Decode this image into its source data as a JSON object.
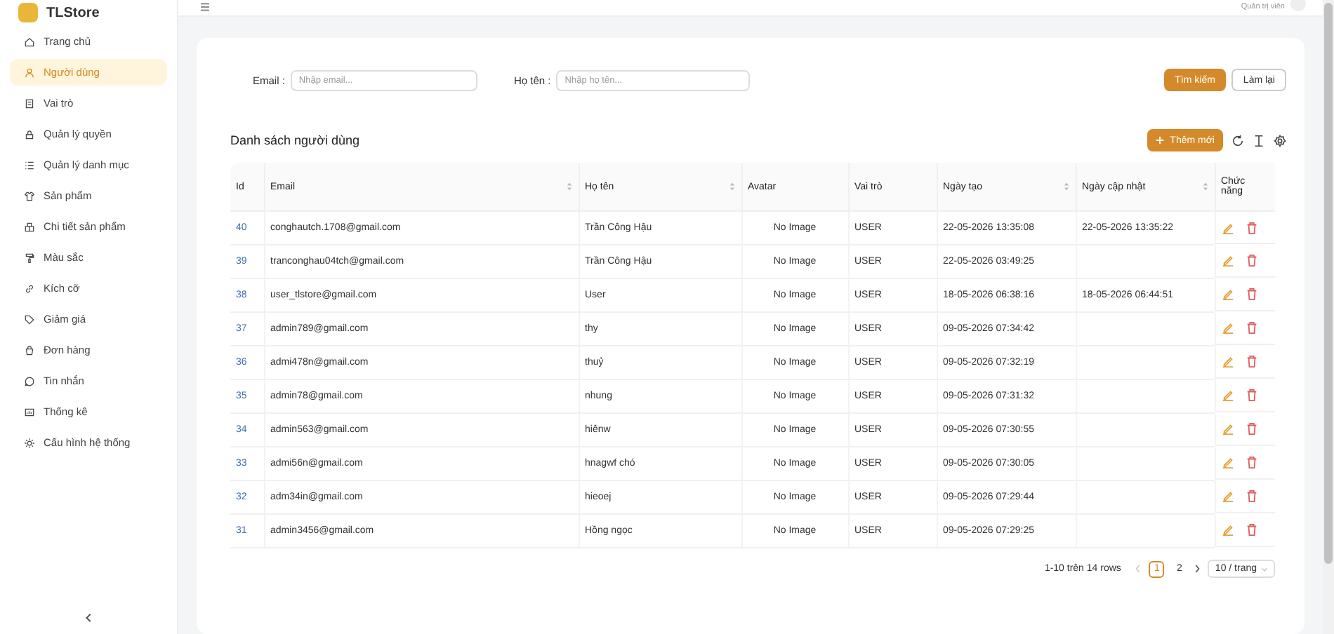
{
  "brand": {
    "name": "TLStore"
  },
  "sidebar": {
    "items": [
      {
        "label": "Trang chủ",
        "selected": false
      },
      {
        "label": "Người dùng",
        "selected": true
      },
      {
        "label": "Vai trò",
        "selected": false
      },
      {
        "label": "Quản lý quyền",
        "selected": false
      },
      {
        "label": "Quản lý danh mục",
        "selected": false
      },
      {
        "label": "Sản phẩm",
        "selected": false
      },
      {
        "label": "Chi tiết sản phẩm",
        "selected": false
      },
      {
        "label": "Màu sắc",
        "selected": false
      },
      {
        "label": "Kích cỡ",
        "selected": false
      },
      {
        "label": "Giảm giá",
        "selected": false
      },
      {
        "label": "Đơn hàng",
        "selected": false
      },
      {
        "label": "Tin nhắn",
        "selected": false
      },
      {
        "label": "Thống kê",
        "selected": false
      },
      {
        "label": "Cấu hình hệ thống",
        "selected": false
      }
    ]
  },
  "header": {
    "user_role": "Quản trị viên"
  },
  "filters": [
    {
      "label": "Email :",
      "placeholder": "Nhập email..."
    },
    {
      "label": "Họ tên :",
      "placeholder": "Nhập họ tên..."
    }
  ],
  "filter_buttons": [
    {
      "label": "Tìm kiếm",
      "kind": "primary"
    },
    {
      "label": "Làm lại",
      "kind": "default"
    }
  ],
  "table_title": "Danh sách người dùng",
  "add_button": "Thêm mới",
  "table": {
    "columns": [
      {
        "label": "Id",
        "sortable": false
      },
      {
        "label": "Email",
        "sortable": true
      },
      {
        "label": "Họ tên",
        "sortable": true
      },
      {
        "label": "Avatar",
        "sortable": false
      },
      {
        "label": "Vai trò",
        "sortable": false
      },
      {
        "label": "Ngày tạo",
        "sortable": true
      },
      {
        "label": "Ngày cập nhật",
        "sortable": true
      },
      {
        "label": "Chức năng",
        "sortable": false
      }
    ],
    "rows": [
      {
        "id": "40",
        "email": "conghautch.1708@gmail.com",
        "name": "Trần Công Hậu",
        "avatar": "No Image",
        "role": "USER",
        "created": "22-05-2026 13:35:08",
        "updated": "22-05-2026 13:35:22"
      },
      {
        "id": "39",
        "email": "tranconghau04tch@gmail.com",
        "name": "Trần Công Hậu",
        "avatar": "No Image",
        "role": "USER",
        "created": "22-05-2026 03:49:25"
      },
      {
        "id": "38",
        "email": "user_tlstore@gmail.com",
        "name": "User",
        "avatar": "No Image",
        "role": "USER",
        "created": "18-05-2026 06:38:16",
        "updated": "18-05-2026 06:44:51"
      },
      {
        "id": "37",
        "email": "admin789@gmail.com",
        "name": "thy",
        "avatar": "No Image",
        "role": "USER",
        "created": "09-05-2026 07:34:42"
      },
      {
        "id": "36",
        "email": "admi478n@gmail.com",
        "name": "thuỷ",
        "avatar": "No Image",
        "role": "USER",
        "created": "09-05-2026 07:32:19"
      },
      {
        "id": "35",
        "email": "admin78@gmail.com",
        "name": "nhung",
        "avatar": "No Image",
        "role": "USER",
        "created": "09-05-2026 07:31:32"
      },
      {
        "id": "34",
        "email": "admin563@gmail.com",
        "name": "hiênw",
        "avatar": "No Image",
        "role": "USER",
        "created": "09-05-2026 07:30:55"
      },
      {
        "id": "33",
        "email": "admi56n@gmail.com",
        "name": "hnagwf chó",
        "avatar": "No Image",
        "role": "USER",
        "created": "09-05-2026 07:30:05"
      },
      {
        "id": "32",
        "email": "adm34in@gmail.com",
        "name": "hieoej",
        "avatar": "No Image",
        "role": "USER",
        "created": "09-05-2026 07:29:44"
      },
      {
        "id": "31",
        "email": "admin3456@gmail.com",
        "name": "Hồng ngọc",
        "avatar": "No Image",
        "role": "USER",
        "created": "09-05-2026 07:29:25"
      }
    ]
  },
  "pagination": {
    "summary": "1-10 trên 14 rows",
    "pages": [
      {
        "label": "1",
        "selected": true
      },
      {
        "label": "2",
        "selected": false
      }
    ],
    "page_size": "10 / trang"
  }
}
